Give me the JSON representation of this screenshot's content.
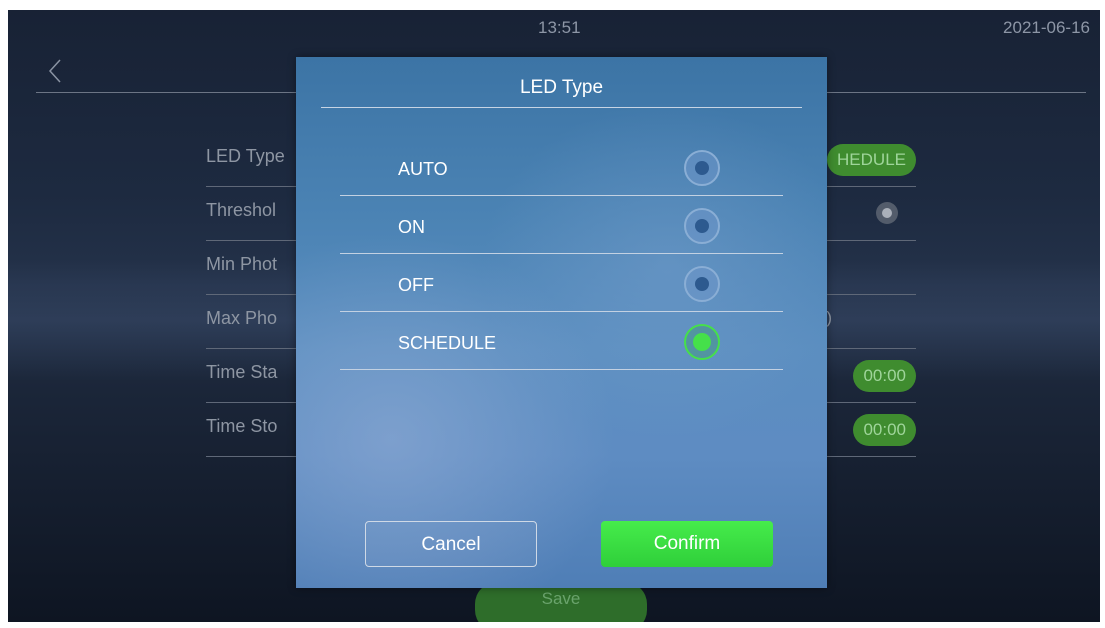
{
  "statusbar": {
    "time": "13:51",
    "date": "2021-06-16"
  },
  "background_settings": {
    "rows": [
      {
        "label": "LED Type",
        "value": "HEDULE",
        "kind": "pill"
      },
      {
        "label": "Threshol",
        "value": "",
        "kind": "radio"
      },
      {
        "label": "Min Phot",
        "value": "",
        "kind": "text"
      },
      {
        "label": "Max Pho",
        "value": ")",
        "kind": "text"
      },
      {
        "label": "Time Sta",
        "value": "00:00",
        "kind": "pill"
      },
      {
        "label": "Time Sto",
        "value": "00:00",
        "kind": "pill"
      }
    ],
    "save_label": "Save"
  },
  "dialog": {
    "title": "LED Type",
    "options": [
      {
        "label": "AUTO",
        "selected": false
      },
      {
        "label": "ON",
        "selected": false
      },
      {
        "label": "OFF",
        "selected": false
      },
      {
        "label": "SCHEDULE",
        "selected": true
      }
    ],
    "cancel_label": "Cancel",
    "confirm_label": "Confirm"
  },
  "colors": {
    "accent_green": "#45e04a",
    "dialog_blue": "#4b83b4",
    "background_dark": "#1d2a40"
  }
}
